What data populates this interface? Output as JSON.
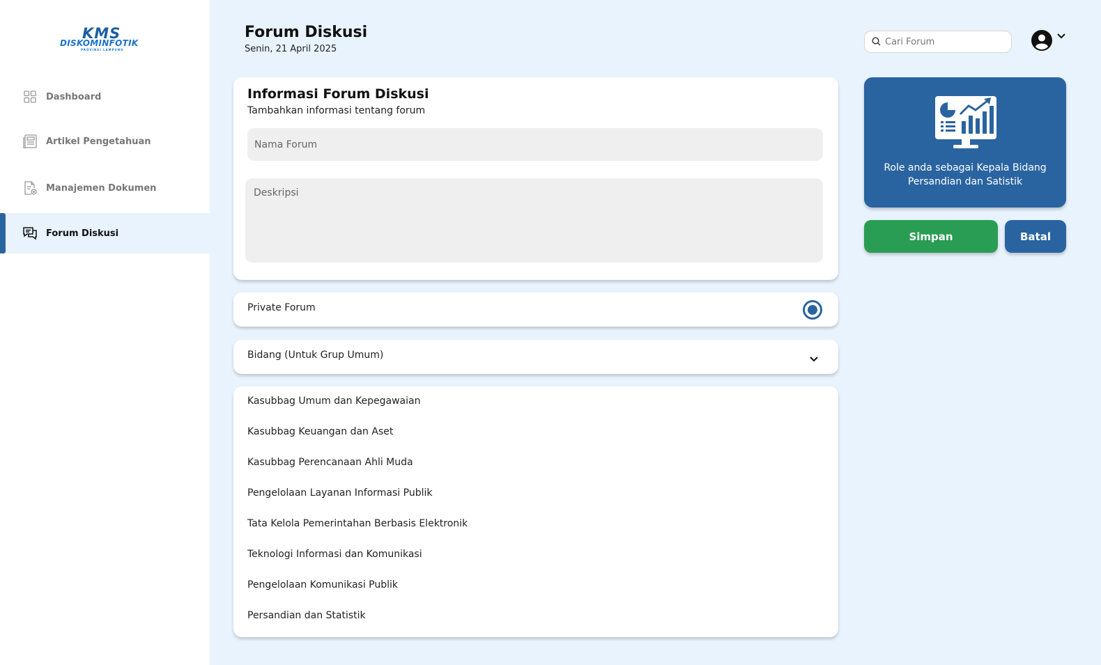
{
  "logo": {
    "line1": "KMS",
    "line2": "DISKOMINFOTIK",
    "line3": "PROVINSI LAMPUNG"
  },
  "sidebar": {
    "items": [
      {
        "label": "Dashboard",
        "icon": "grid-icon",
        "active": false
      },
      {
        "label": "Artikel Pengetahuan",
        "icon": "newspaper-icon",
        "active": false
      },
      {
        "label": "Manajemen Dokumen",
        "icon": "document-settings-icon",
        "active": false
      },
      {
        "label": "Forum Diskusi",
        "icon": "chat-icon",
        "active": true
      }
    ]
  },
  "header": {
    "title": "Forum Diskusi",
    "date": "Senin, 21 April 2025",
    "search_placeholder": "Cari Forum"
  },
  "info": {
    "title": "Informasi Forum Diskusi",
    "subtitle": "Tambahkan informasi tentang forum",
    "nama_placeholder": "Nama Forum",
    "deskripsi_placeholder": "Deskripsi"
  },
  "private_forum": {
    "label": "Private Forum",
    "selected": true
  },
  "bidang": {
    "label": "Bidang (Untuk Grup Umum)",
    "options": [
      "Kasubbag Umum dan Kepegawaian",
      "Kasubbag Keuangan dan Aset",
      "Kasubbag Perencanaan Ahli Muda",
      "Pengelolaan Layanan Informasi Publik",
      "Tata Kelola Pemerintahan Berbasis Elektronik",
      "Teknologi Informasi dan Komunikasi",
      "Pengelolaan Komunikasi Publik",
      "Persandian dan Statistik"
    ]
  },
  "role": {
    "text": "Role anda sebagai Kepala Bidang Persandian dan Satistik"
  },
  "actions": {
    "save_label": "Simpan",
    "cancel_label": "Batal"
  },
  "colors": {
    "primary": "#2a64a0",
    "success": "#2a9d54",
    "background": "#e8f3fd"
  }
}
